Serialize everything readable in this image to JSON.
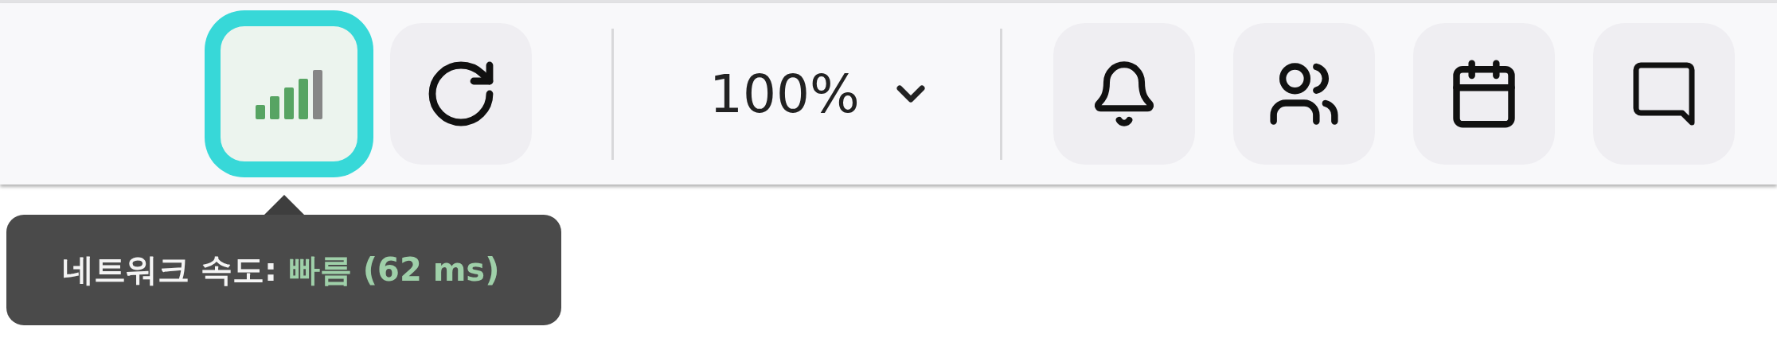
{
  "toolbar": {
    "network_button": {
      "focused": true
    },
    "zoom": {
      "value": "100%"
    },
    "buttons": [
      {
        "kind": "bell"
      },
      {
        "kind": "users"
      },
      {
        "kind": "calendar"
      },
      {
        "kind": "chat"
      }
    ]
  },
  "tooltip": {
    "text": "네트워크 속도: **빠름 (62 ms)**"
  }
}
